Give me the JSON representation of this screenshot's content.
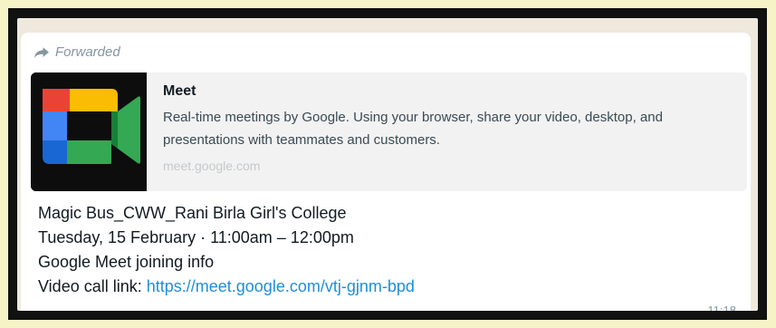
{
  "message": {
    "forwarded_label": "Forwarded",
    "preview": {
      "title": "Meet",
      "description": "Real-time meetings by Google. Using your browser, share your video, desktop, and presentations with teammates and customers.",
      "domain": "meet.google.com"
    },
    "body": {
      "line1": "Magic Bus_CWW_Rani Birla Girl's College",
      "line2": "Tuesday, 15 February · 11:00am – 12:00pm",
      "line3": "Google Meet joining info",
      "link_label": "Video call link: ",
      "link_url": "https://meet.google.com/vtj-gjnm-bpd"
    },
    "timestamp": "11:18"
  },
  "icons": {
    "forward": "forward-arrow-icon",
    "meet_logo": "google-meet-logo-icon"
  },
  "colors": {
    "background": "#f6f4c7",
    "chat_background": "#efe8dd",
    "bubble": "#ffffff",
    "preview_background": "#f2f2f2",
    "link": "#1f8ed8",
    "meta": "#8696a0",
    "text": "#111b21"
  }
}
